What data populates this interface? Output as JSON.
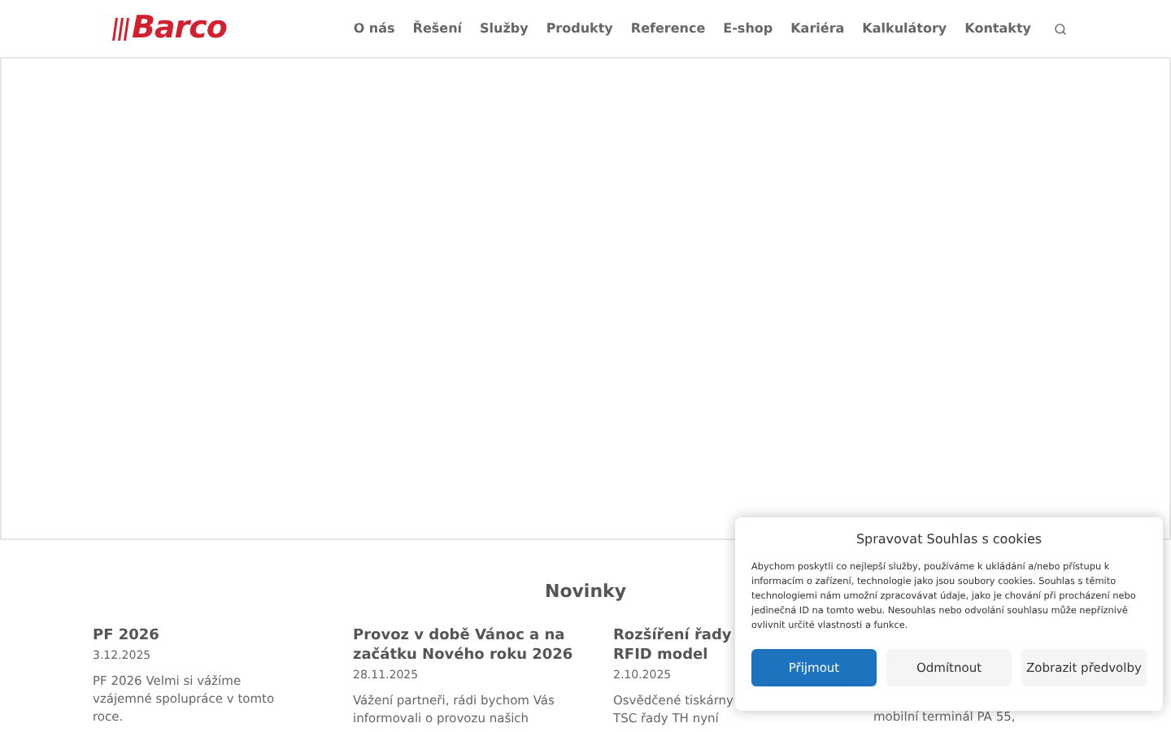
{
  "logo": {
    "text": "Barco"
  },
  "nav": {
    "items": [
      {
        "label": "O nás"
      },
      {
        "label": "Řešení"
      },
      {
        "label": "Služby"
      },
      {
        "label": "Produkty"
      },
      {
        "label": "Reference"
      },
      {
        "label": "E-shop"
      },
      {
        "label": "Kariéra"
      },
      {
        "label": "Kalkulátory"
      },
      {
        "label": "Kontakty"
      }
    ]
  },
  "news": {
    "heading": "Novinky",
    "items": [
      {
        "title_lines": [
          "PF 2026"
        ],
        "date": "3.12.2025",
        "excerpt_lines": [
          "PF 2026 Velmi si vážíme",
          "vzájemné spolupráce v tomto",
          "roce."
        ]
      },
      {
        "title_lines": [
          "Provoz v době Vánoc a na",
          "začátku Nového roku 2026"
        ],
        "date": "28.11.2025",
        "excerpt_lines": [
          "Vážení partneři, rádi bychom Vás",
          "informovali o provozu našich"
        ]
      },
      {
        "title_lines": [
          "Rozšíření řady",
          "RFID model"
        ],
        "date": "2.10.2025",
        "excerpt_lines": [
          "Osvědčené tiskárny",
          "TSC řady TH nyní"
        ]
      },
      {
        "excerpt_lines": [
          "mobilní terminál PA 55,"
        ]
      }
    ]
  },
  "cookie_dialog": {
    "title": "Spravovat Souhlas s cookies",
    "text": "Abychom poskytli co nejlepší služby, používáme k ukládání a/nebo přístupu k informacím o zařízení, technologie jako jsou soubory cookies. Souhlas s těmito technologiemi nám umožní zpracovávat údaje, jako je chování při procházení nebo jedinečná ID na tomto webu. Nesouhlas nebo odvolání souhlasu může nepříznivě ovlivnit určité vlastnosti a funkce.",
    "buttons": [
      {
        "label": "Přijmout",
        "kind": "primary"
      },
      {
        "label": "Odmítnout",
        "kind": "secondary"
      },
      {
        "label": "Zobrazit předvolby",
        "kind": "secondary"
      }
    ]
  }
}
